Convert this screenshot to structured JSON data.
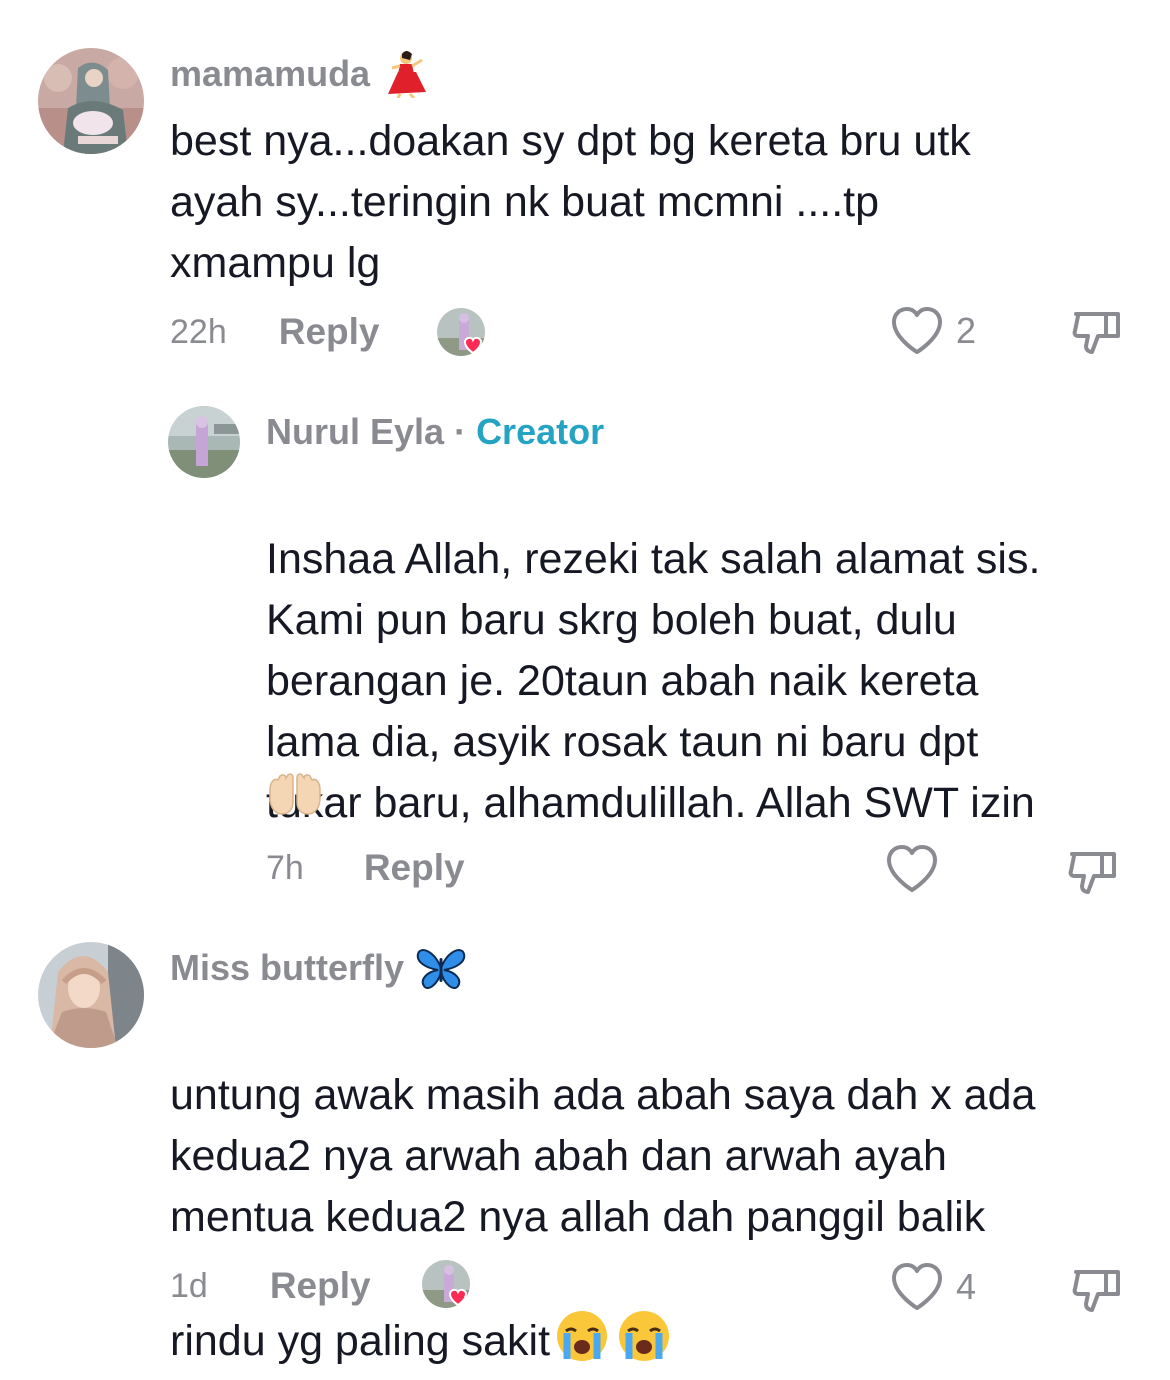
{
  "comments": [
    {
      "username": "mamamuda",
      "username_emoji": "woman-dancing-emoji",
      "text": "best nya...doakan sy dpt bg kereta bru utk\nayah sy...teringin nk buat mcmni ....tp\nxmampu lg",
      "time": "22h",
      "reply_label": "Reply",
      "creator_liked": true,
      "likes": "2"
    },
    {
      "username": "Nurul Eyla",
      "separator": "·",
      "badge": "Creator",
      "text": "Inshaa Allah, rezeki tak salah alamat sis.\nKami pun baru skrg boleh buat, dulu\nberangan je. 20taun abah naik kereta\nlama dia, asyik rosak taun ni baru dpt\ntukar baru, alhamdulillah. Allah SWT izin",
      "trailing_emoji": "palms-up-together-emoji",
      "time": "7h",
      "reply_label": "Reply",
      "likes": ""
    },
    {
      "username": "Miss butterfly",
      "username_emoji": "butterfly-emoji",
      "text": "untung awak masih ada abah saya dah x ada\nkedua2 nya arwah abah dan arwah ayah\nmentua kedua2 nya allah dah panggil balik\nrindu yg paling sakit",
      "trailing_emoji": "loudly-crying-face-emoji x2",
      "time": "1d",
      "reply_label": "Reply",
      "creator_liked": true,
      "likes": "4"
    }
  ],
  "colors": {
    "secondary_text": "#8a8b91",
    "primary_text": "#161823",
    "creator_badge": "#25a3c2",
    "heart_red": "#fe2c55"
  }
}
